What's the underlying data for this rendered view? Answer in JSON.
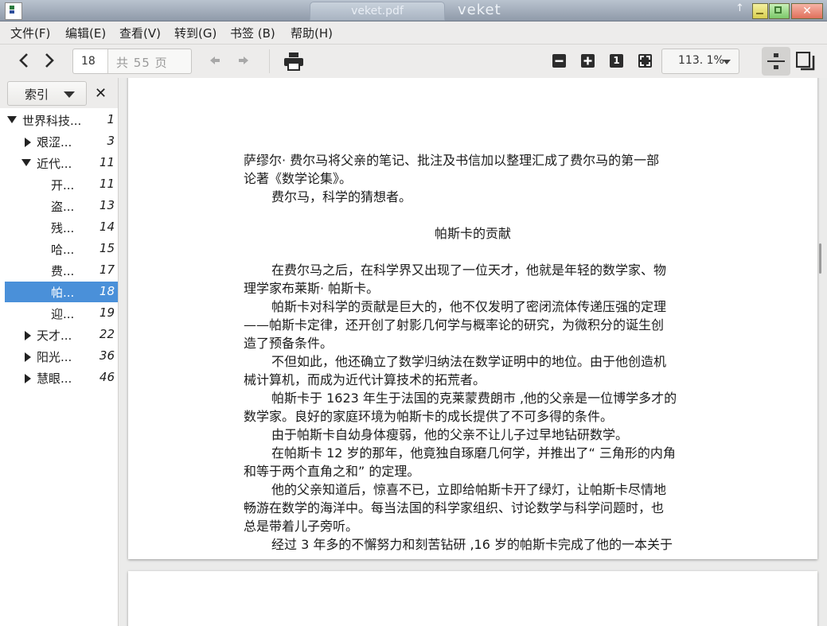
{
  "window": {
    "tab_title": "veket.pdf",
    "title": "veket",
    "close_glyph": "✕",
    "up_glyph": "↑"
  },
  "menu": [
    "文件(F)",
    "编辑(E)",
    "查看(V)",
    "转到(G)",
    "书签 (B)",
    "帮助(H)"
  ],
  "toolbar": {
    "page_current": "18",
    "page_total": "共 55 页",
    "zoom": "113. 1%",
    "zoom_actual_glyph": "1",
    "icons": [
      "chevron-left-icon",
      "chevron-right-icon",
      "history-back-icon",
      "history-forward-icon",
      "print-icon",
      "zoom-out-icon",
      "zoom-in-icon",
      "zoom-actual-size-icon",
      "zoom-fit-icon",
      "continuous-view-icon",
      "dual-page-icon"
    ]
  },
  "sidebar": {
    "mode": "索引",
    "close_glyph": "✕",
    "items": [
      {
        "label": "世界科技...",
        "page": "1",
        "state": "expanded",
        "level": 0
      },
      {
        "label": "艰涩...",
        "page": "3",
        "state": "collapsed",
        "level": 1
      },
      {
        "label": "近代...",
        "page": "11",
        "state": "expanded",
        "level": 1
      },
      {
        "label": "开...",
        "page": "11",
        "state": "leaf",
        "level": 2
      },
      {
        "label": "盗...",
        "page": "13",
        "state": "leaf",
        "level": 2
      },
      {
        "label": "残...",
        "page": "14",
        "state": "leaf",
        "level": 2
      },
      {
        "label": "哈...",
        "page": "15",
        "state": "leaf",
        "level": 2
      },
      {
        "label": "费...",
        "page": "17",
        "state": "leaf",
        "level": 2
      },
      {
        "label": "帕...",
        "page": "18",
        "state": "leaf",
        "level": 2,
        "selected": true
      },
      {
        "label": "迎...",
        "page": "19",
        "state": "leaf",
        "level": 2
      },
      {
        "label": "天才...",
        "page": "22",
        "state": "collapsed",
        "level": 1
      },
      {
        "label": "阳光...",
        "page": "36",
        "state": "collapsed",
        "level": 1
      },
      {
        "label": "慧眼...",
        "page": "46",
        "state": "collapsed",
        "level": 1
      }
    ]
  },
  "document": {
    "lines": [
      {
        "text": "萨缪尔· 费尔马将父亲的笔记、批注及书信加以整理汇成了费尔马的第一部",
        "style": "normal"
      },
      {
        "text": "论著《数学论集》。",
        "style": "normal"
      },
      {
        "text": "费尔马，科学的猜想者。",
        "style": "indent"
      },
      {
        "text": "帕斯卡的贡献",
        "style": "center"
      },
      {
        "text": "在费尔马之后，在科学界又出现了一位天才，他就是年轻的数学家、物",
        "style": "indent"
      },
      {
        "text": "理学家布莱斯· 帕斯卡。",
        "style": "normal"
      },
      {
        "text": "帕斯卡对科学的贡献是巨大的，他不仅发明了密闭流体传递压强的定理",
        "style": "indent"
      },
      {
        "text": "——帕斯卡定律，还开创了射影几何学与概率论的研究，为微积分的诞生创",
        "style": "normal"
      },
      {
        "text": "造了预备条件。",
        "style": "normal"
      },
      {
        "text": "不但如此，他还确立了数学归纳法在数学证明中的地位。由于他创造机",
        "style": "indent"
      },
      {
        "text": "械计算机，而成为近代计算技术的拓荒者。",
        "style": "normal"
      },
      {
        "text": "帕斯卡于 1623 年生于法国的克莱蒙费朗市 ,他的父亲是一位博学多才的",
        "style": "indent"
      },
      {
        "text": "数学家。良好的家庭环境为帕斯卡的成长提供了不可多得的条件。",
        "style": "normal"
      },
      {
        "text": "由于帕斯卡自幼身体瘦弱，他的父亲不让儿子过早地钻研数学。",
        "style": "indent"
      },
      {
        "text": "在帕斯卡 12 岁的那年，他竟独自琢磨几何学，并推出了“ 三角形的内角",
        "style": "indent"
      },
      {
        "text": "和等于两个直角之和” 的定理。",
        "style": "normal"
      },
      {
        "text": "他的父亲知道后，惊喜不已，立即给帕斯卡开了绿灯，让帕斯卡尽情地",
        "style": "indent"
      },
      {
        "text": "畅游在数学的海洋中。每当法国的科学家组织、讨论数学与科学问题时，也",
        "style": "normal"
      },
      {
        "text": "总是带着儿子旁听。",
        "style": "normal"
      },
      {
        "text": "经过 3 年多的不懈努力和刻苦钻研 ,16 岁的帕斯卡完成了他的一本关于",
        "style": "indent"
      }
    ]
  },
  "colors": {
    "selection": "#4a90d9",
    "chrome": "#edeceb",
    "doc_background": "#ebebea"
  }
}
